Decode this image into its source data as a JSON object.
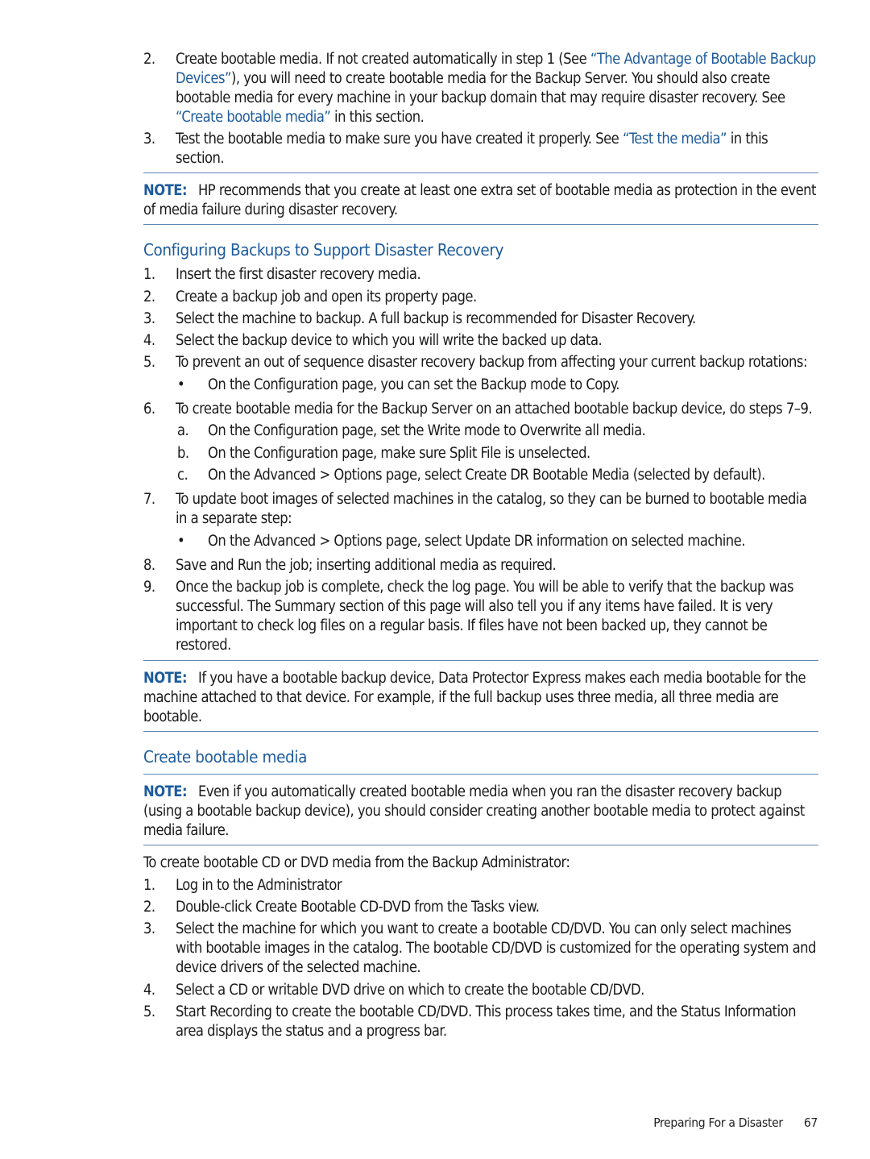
{
  "intro_list": [
    {
      "num": "2.",
      "parts": [
        {
          "text": "Create bootable media. If not created automatically in step 1 (See ",
          "link": false
        },
        {
          "text": "“The Advantage of Bootable Backup Devices”",
          "link": true
        },
        {
          "text": "), you will need to create bootable media for the Backup Server. You should also create bootable media for every machine in your backup domain that may require disaster recovery. See ",
          "link": false
        },
        {
          "text": "“Create bootable media”",
          "link": true
        },
        {
          "text": " in this section.",
          "link": false
        }
      ]
    },
    {
      "num": "3.",
      "parts": [
        {
          "text": "Test the bootable media to make sure you have created it properly. See ",
          "link": false
        },
        {
          "text": "“Test the media”",
          "link": true
        },
        {
          "text": " in this section.",
          "link": false
        }
      ]
    }
  ],
  "note1": {
    "label": "NOTE:",
    "text": "HP recommends that you create at least one extra set of bootable media as protection in the event of media failure during disaster recovery."
  },
  "section1": {
    "heading": "Configuring Backups to Support Disaster Recovery",
    "steps": [
      {
        "num": "1.",
        "text": "Insert the first disaster recovery media."
      },
      {
        "num": "2.",
        "text": "Create a backup job and open its property page."
      },
      {
        "num": "3.",
        "text": "Select the machine to backup. A full backup is recommended for Disaster Recovery."
      },
      {
        "num": "4.",
        "text": "Select the backup device to which you will write the backed up data."
      },
      {
        "num": "5.",
        "text": "To prevent an out of sequence disaster recovery backup from affecting your current backup rotations:",
        "sub": [
          {
            "marker": "•",
            "text": "On the Configuration page, you can set the Backup mode to Copy."
          }
        ]
      },
      {
        "num": "6.",
        "text": "To create bootable media for the Backup Server on an attached bootable backup device, do steps 7–9.",
        "sub": [
          {
            "marker": "a.",
            "text": "On the Configuration page, set the Write mode to Overwrite all media."
          },
          {
            "marker": "b.",
            "text": "On the Configuration page, make sure Split File is unselected."
          },
          {
            "marker": "c.",
            "text": "On the Advanced > Options page, select Create DR Bootable Media (selected by default)."
          }
        ]
      },
      {
        "num": "7.",
        "text": "To update boot images of selected machines in the catalog, so they can be burned to bootable media in a separate step:",
        "sub": [
          {
            "marker": "•",
            "text": "On the Advanced > Options page, select Update DR information on selected machine."
          }
        ]
      },
      {
        "num": "8.",
        "text": "Save and Run the job; inserting additional media as required."
      },
      {
        "num": "9.",
        "text": "Once the backup job is complete, check the log page. You will be able to verify that the backup was successful. The Summary section of this page will also tell you if any items have failed. It is very important to check log files on a regular basis. If files have not been backed up, they cannot be restored."
      }
    ]
  },
  "note2": {
    "label": "NOTE:",
    "text": "If you have a bootable backup device, Data Protector Express makes each media bootable for the machine attached to that device. For example, if the full backup uses three media, all three media are bootable."
  },
  "section2": {
    "heading": "Create bootable media",
    "note": {
      "label": "NOTE:",
      "text": "Even if you automatically created bootable media when you ran the disaster recovery backup (using a bootable backup device), you should consider creating another bootable media to protect against media failure."
    },
    "intro": "To create bootable CD or DVD media from the Backup Administrator:",
    "steps": [
      {
        "num": "1.",
        "text": "Log in to the Administrator"
      },
      {
        "num": "2.",
        "text": "Double-click Create Bootable CD-DVD from the Tasks view."
      },
      {
        "num": "3.",
        "text": "Select the machine for which you want to create a bootable CD/DVD. You can only select machines with bootable images in the catalog. The bootable CD/DVD is customized for the operating system and device drivers of the selected machine."
      },
      {
        "num": "4.",
        "text": "Select a CD or writable DVD drive on which to create the bootable CD/DVD."
      },
      {
        "num": "5.",
        "text": "Start Recording to create the bootable CD/DVD. This process takes time, and the Status Information area displays the status and a progress bar."
      }
    ]
  },
  "footer": {
    "section_title": "Preparing For a Disaster",
    "page_number": "67"
  }
}
